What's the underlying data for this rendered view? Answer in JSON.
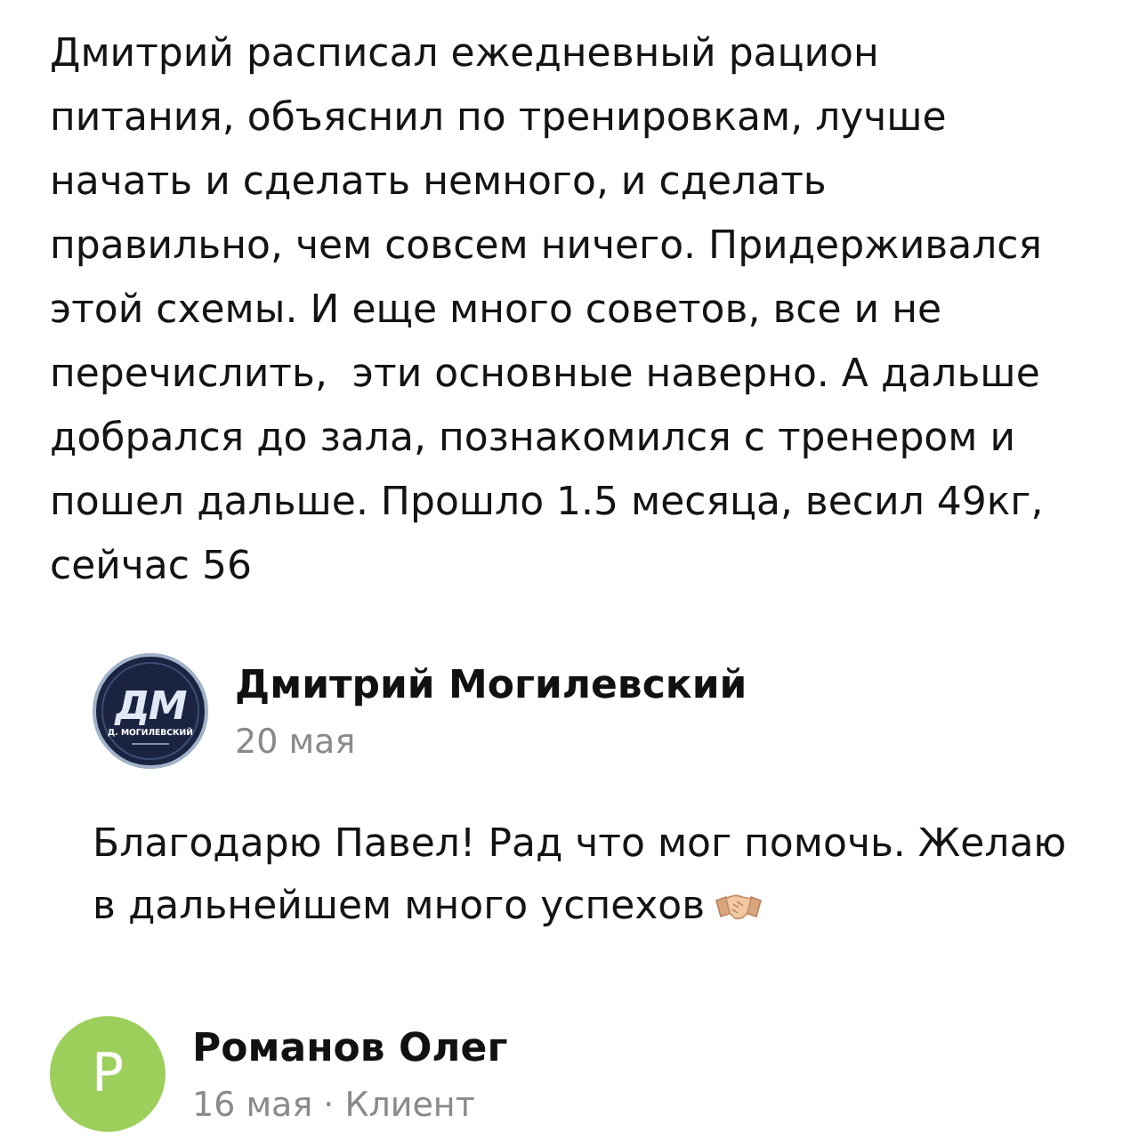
{
  "review": {
    "text_lines": [
      "Дмитрий расписал ежедневный рацион",
      "питания, объяснил по тренировкам, лучше",
      "начать и сделать немного, и сделать",
      "правильно, чем совсем ничего. Придерживался",
      "этой схемы. И еще много советов, все и не",
      "перечислить,  эти основные наверно. А дальше",
      "добрался до зала, познакомился с тренером и",
      "пошел дальше. Прошло 1.5 месяца, весил 49кг,",
      "сейчас 56"
    ]
  },
  "reply": {
    "avatar": {
      "kind": "logo",
      "monogram": "ДМ",
      "caption": "Д. МОГИЛЕВСКИЙ"
    },
    "author": "Дмитрий Могилевский",
    "date": "20 мая",
    "text_lines": [
      "Благодарю Павел! Рад что мог помочь. Желаю",
      "в дальнейшем много успехов"
    ]
  },
  "next_review": {
    "avatar": {
      "kind": "letter",
      "letter": "Р"
    },
    "author": "Романов Олег",
    "meta": "16 мая · Клиент"
  }
}
